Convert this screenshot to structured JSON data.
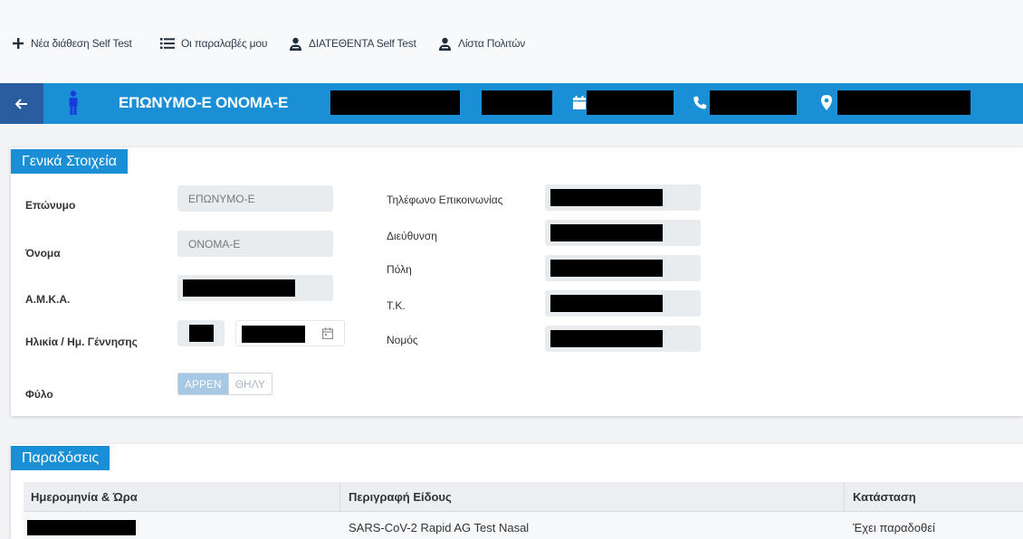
{
  "nav": {
    "new_selftest": "Νέα διάθεση Self Test",
    "my_receipts": "Οι παραλαβές μου",
    "available_selftest": "ΔΙΑΤΕΘΕΝΤΑ Self Test",
    "citizens_list": "Λίστα Πολιτών"
  },
  "header": {
    "patient_name": "ΕΠΩΝΥΜΟ-Ε ΟΝΟΜΑ-Ε",
    "back_icon": "arrow-left-icon",
    "person_icon": "male-person-icon",
    "calendar_icon": "calendar-icon",
    "phone_icon": "phone-icon",
    "location_icon": "map-marker-icon"
  },
  "general": {
    "title": "Γενικά Στοιχεία",
    "surname_label": "Επώνυμο",
    "surname_value": "ΕΠΩΝΥΜΟ-Ε",
    "name_label": "Όνομα",
    "name_value": "ΟΝΟΜΑ-Ε",
    "amka_label": "Α.Μ.Κ.Α.",
    "age_birth_label": "Ηλικία / Ημ. Γέννησης",
    "gender_label": "Φύλο",
    "gender_male": "ΑΡΡΕΝ",
    "gender_female": "ΘΗΛΥ",
    "gender_selected": "ΑΡΡΕΝ",
    "phone_label": "Τηλέφωνο Επικοινωνίας",
    "address_label": "Διεύθυνση",
    "city_label": "Πόλη",
    "zip_label": "Τ.Κ.",
    "prefecture_label": "Νομός"
  },
  "deliveries": {
    "title": "Παραδόσεις",
    "columns": [
      "Ημερομηνία & Ώρα",
      "Περιγραφή Είδους",
      "Κατάσταση"
    ],
    "rows": [
      {
        "description": "SARS-CoV-2 Rapid AG Test Nasal",
        "status": "Έχει παραδοθεί"
      }
    ]
  },
  "colors": {
    "primary": "#1a8fd6",
    "back_button": "#2a5d9f",
    "input_bg": "#e9ecef",
    "toggle_active": "#a7c9e4",
    "redaction": "#000000"
  }
}
